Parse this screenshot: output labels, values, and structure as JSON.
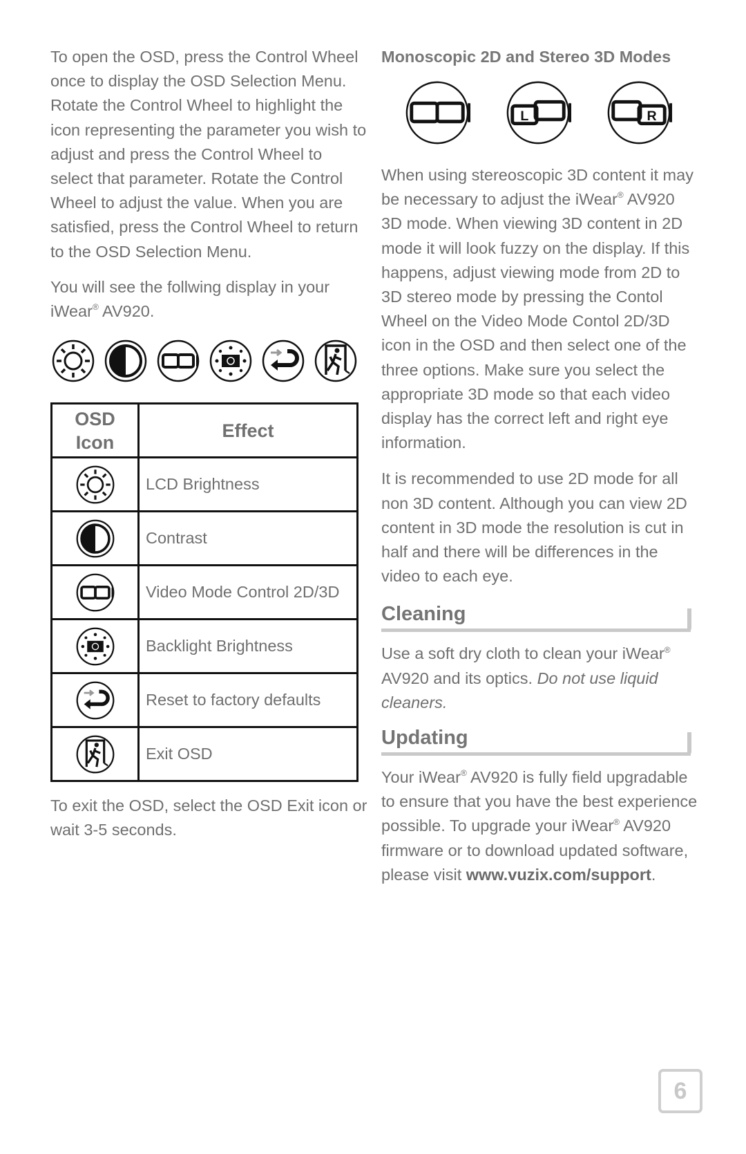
{
  "left_column": {
    "intro_paragraph": "To open the OSD, press the Control Wheel once to display the OSD Selection Menu.  Rotate the Control Wheel to highlight the icon representing the parameter you wish to adjust and press the Control Wheel to select that parameter.  Rotate the Control Wheel to adjust the value.  When you are satisfied, press the Control Wheel to return to the OSD Selection Menu.",
    "display_intro_before": "You will see the follwing display in your iWear",
    "display_intro_reg": "®",
    "display_intro_after": " AV920.",
    "icon_strip": [
      "sun-icon",
      "contrast-icon",
      "glasses-icon",
      "backlight-icon",
      "reset-arrow-icon",
      "exit-door-icon"
    ],
    "table": {
      "header_icon_line1": "OSD",
      "header_icon_line2": "Icon",
      "header_effect": "Effect",
      "rows": [
        {
          "icon": "sun-icon",
          "effect": "LCD Brightness"
        },
        {
          "icon": "contrast-icon",
          "effect": "Contrast"
        },
        {
          "icon": "glasses-icon",
          "effect": "Video Mode Control 2D/3D"
        },
        {
          "icon": "backlight-icon",
          "effect": "Backlight Brightness"
        },
        {
          "icon": "reset-arrow-icon",
          "effect": "Reset to factory defaults"
        },
        {
          "icon": "exit-door-icon",
          "effect": "Exit OSD"
        }
      ]
    },
    "exit_paragraph": "To exit the OSD, select the OSD Exit icon or wait 3-5 seconds."
  },
  "right_column": {
    "modes_heading": "Monoscopic 2D and Stereo 3D Modes",
    "mode_icons": [
      {
        "icon": "glasses-2d-icon",
        "letter": ""
      },
      {
        "icon": "glasses-left-icon",
        "letter": "L"
      },
      {
        "icon": "glasses-right-icon",
        "letter": "R"
      }
    ],
    "stereo_para_1": "When using stereoscopic 3D content it may be necessary to adjust the iWear",
    "reg": "®",
    "stereo_para_2": " AV920 3D mode.  When viewing 3D content in 2D mode it will look fuzzy on the display.  If this happens, adjust viewing mode from 2D to 3D stereo mode by pressing the Contol Wheel on the Video Mode Contol 2D/3D icon in the OSD and then select one of the three options.  Make sure you select the appropriate 3D mode so that  each video display has the correct left and right eye information.",
    "recommend_paragraph": "It is recommended to use 2D mode for all non 3D content.  Although you can view 2D content in 3D mode the resolution is cut in half and there will be differences in the video to each eye.",
    "cleaning": {
      "heading": "Cleaning",
      "text_1": "Use a soft dry cloth to clean your iWear",
      "text_2": " AV920 and its optics. ",
      "italic": "Do not use liquid cleaners."
    },
    "updating": {
      "heading": "Updating",
      "text_1": "Your iWear",
      "text_2": " AV920 is fully field upgradable to ensure that you have the best experience possible. To upgrade your iWear",
      "text_3": " AV920 firmware or to download updated software, please visit ",
      "url": "www.vuzix.com/support",
      "text_4": "."
    }
  },
  "page_number": "6"
}
